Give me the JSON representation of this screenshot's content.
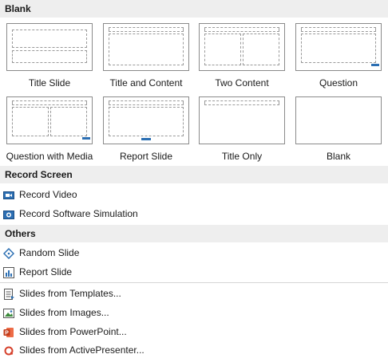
{
  "sections": {
    "blank": "Blank",
    "record": "Record Screen",
    "others": "Others"
  },
  "layouts": [
    {
      "label": "Title Slide"
    },
    {
      "label": "Title and Content"
    },
    {
      "label": "Two Content"
    },
    {
      "label": "Question"
    },
    {
      "label": "Question with Media"
    },
    {
      "label": "Report Slide"
    },
    {
      "label": "Title Only"
    },
    {
      "label": "Blank"
    }
  ],
  "record_items": [
    {
      "label": "Record Video",
      "icon": "video-camera-icon"
    },
    {
      "label": "Record Software Simulation",
      "icon": "camera-icon"
    }
  ],
  "others_items": [
    {
      "label": "Random Slide",
      "icon": "random-slide-icon"
    },
    {
      "label": "Report Slide",
      "icon": "report-chart-icon"
    }
  ],
  "import_items": [
    {
      "label": "Slides from Templates...",
      "icon": "template-icon"
    },
    {
      "label": "Slides from Images...",
      "icon": "image-icon"
    },
    {
      "label": "Slides from PowerPoint...",
      "icon": "powerpoint-icon"
    },
    {
      "label": "Slides from ActivePresenter...",
      "icon": "activepresenter-icon"
    }
  ],
  "colors": {
    "accent": "#2c6fb3",
    "header_bg": "#eeeeee"
  }
}
